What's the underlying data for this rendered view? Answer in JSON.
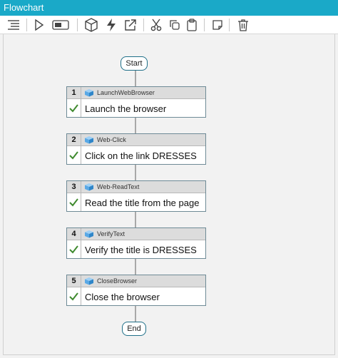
{
  "window": {
    "title": "Flowchart"
  },
  "toolbar": {
    "icons": [
      "align-icon",
      "play-icon",
      "toggle-icon",
      "package-icon",
      "lightning-icon",
      "external-link-icon",
      "cut-icon",
      "copy-icon",
      "paste-icon",
      "note-icon",
      "delete-icon"
    ]
  },
  "flow": {
    "start_label": "Start",
    "end_label": "End",
    "steps": [
      {
        "number": "1",
        "type": "LaunchWebBrowser",
        "description": "Launch the browser",
        "status": "passed"
      },
      {
        "number": "2",
        "type": "Web-Click",
        "description": "Click on the link DRESSES",
        "status": "passed"
      },
      {
        "number": "3",
        "type": "Web-ReadText",
        "description": "Read the title from the page",
        "status": "passed"
      },
      {
        "number": "4",
        "type": "VerifyText",
        "description": "Verify the title is DRESSES",
        "status": "passed"
      },
      {
        "number": "5",
        "type": "CloseBrowser",
        "description": "Close the browser",
        "status": "passed"
      }
    ]
  },
  "colors": {
    "title_bar": "#1aa9c8",
    "check": "#3f8a2e",
    "cube": "#5aa9e6"
  }
}
